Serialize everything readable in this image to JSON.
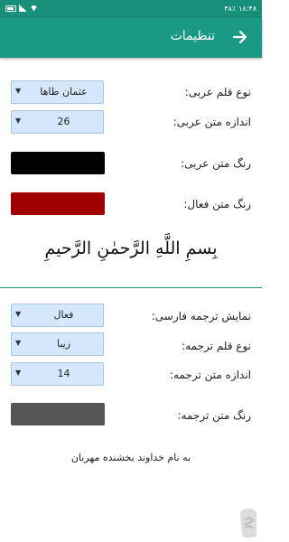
{
  "status_bar": {
    "time": "۱۸:۴۸",
    "battery": "۴۸٪",
    "icons": [
      "signal-icon",
      "wifi-icon",
      "battery-icon",
      "alarm-icon",
      "settings-icon",
      "sms-icon"
    ]
  },
  "header": {
    "title": "تنظیمات",
    "back_icon": "arrow-right-icon"
  },
  "settings": {
    "arabic_font_label": "نوع قلم عربی:",
    "arabic_font_value": "عثمان طاها",
    "arabic_size_label": "اندازه متن عربی:",
    "arabic_size_value": "26",
    "arabic_color_label": "رنگ متن عربی:",
    "arabic_color": "#000000",
    "active_color_label": "رنگ متن فعال:",
    "active_color": "#a00000"
  },
  "arabic_preview": "بِسمِ اللَّهِ الرَّحمٰنِ الرَّحيمِ",
  "translation": {
    "show_label": "نمایش ترجمه فارسی:",
    "show_value": "فعال",
    "font_label": "نوع قلم ترجمه:",
    "font_value": "زیبا",
    "size_label": "اندازه متن ترجمه:",
    "size_value": "14",
    "color_label": "رنگ متن ترجمه:",
    "color": "#555555"
  },
  "persian_preview": "به نام خداوند بخشنده مهربان",
  "colors": {
    "status_bar": "#178f7b",
    "app_bar": "#1a9a85",
    "dropdown_bg": "#d5e7fb"
  }
}
